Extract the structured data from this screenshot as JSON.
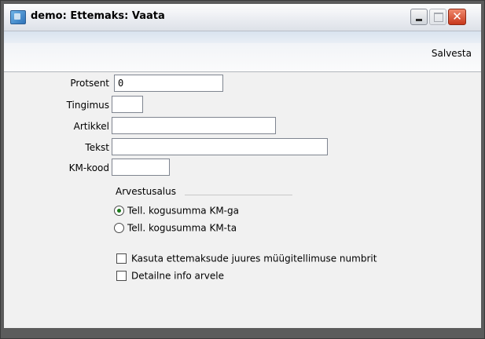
{
  "window": {
    "title": "demo: Ettemaks: Vaata"
  },
  "toolbar": {
    "save_label": "Salvesta"
  },
  "form": {
    "fields": [
      {
        "label": "Protsent",
        "value": "0"
      },
      {
        "label": "Tingimus",
        "value": ""
      },
      {
        "label": "Artikkel",
        "value": ""
      },
      {
        "label": "Tekst",
        "value": ""
      },
      {
        "label": "KM-kood",
        "value": ""
      }
    ],
    "calc_group": {
      "title": "Arvestusalus",
      "options": [
        {
          "label": "Tell. kogusumma KM-ga",
          "selected": true
        },
        {
          "label": "Tell. kogusumma KM-ta",
          "selected": false
        }
      ]
    },
    "checkboxes": [
      {
        "label": "Kasuta ettemaksude juures müügitellimuse numbrit",
        "checked": false
      },
      {
        "label": "Detailne info arvele",
        "checked": false
      }
    ]
  },
  "icons": {
    "app": "app-window-icon",
    "minimize": "minimize-icon",
    "maximize": "maximize-icon",
    "close": "close-icon"
  },
  "colors": {
    "close_button": "#d9472b",
    "radio_selected": "#1a7a1a"
  }
}
